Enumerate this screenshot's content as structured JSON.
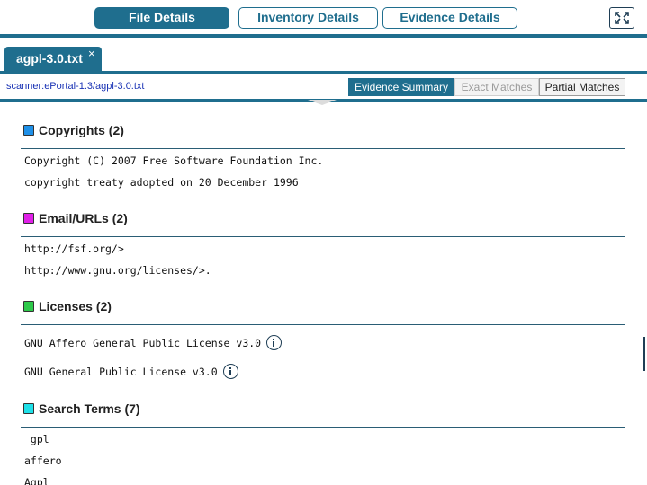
{
  "tabs": {
    "file_details": "File Details",
    "inventory_details": "Inventory Details",
    "evidence_details": "Evidence Details"
  },
  "file_tab": {
    "name": "agpl-3.0.txt",
    "close": "×"
  },
  "path": "scanner:ePortal-1.3/agpl-3.0.txt",
  "view_modes": {
    "summary": "Evidence Summary",
    "exact": "Exact Matches",
    "partial": "Partial Matches"
  },
  "sections": {
    "copyrights": {
      "title": "Copyrights (2)",
      "color": "#1e90e8",
      "items": [
        "Copyright (C) 2007 Free Software Foundation Inc.",
        "copyright treaty adopted on 20 December 1996"
      ]
    },
    "emails": {
      "title": "Email/URLs (2)",
      "color": "#e020e8",
      "items": [
        "http://fsf.org/>",
        "http://www.gnu.org/licenses/>."
      ]
    },
    "licenses": {
      "title": "Licenses (2)",
      "color": "#2ec94a",
      "items": [
        "GNU Affero General Public License v3.0",
        "GNU General Public License v3.0"
      ]
    },
    "search_terms": {
      "title": "Search Terms (7)",
      "color": "#1ee0e8",
      "items": [
        " gpl",
        "affero",
        "Agpl"
      ]
    }
  },
  "colors": {
    "accent": "#1f6e8e",
    "link": "#1a33b5"
  }
}
